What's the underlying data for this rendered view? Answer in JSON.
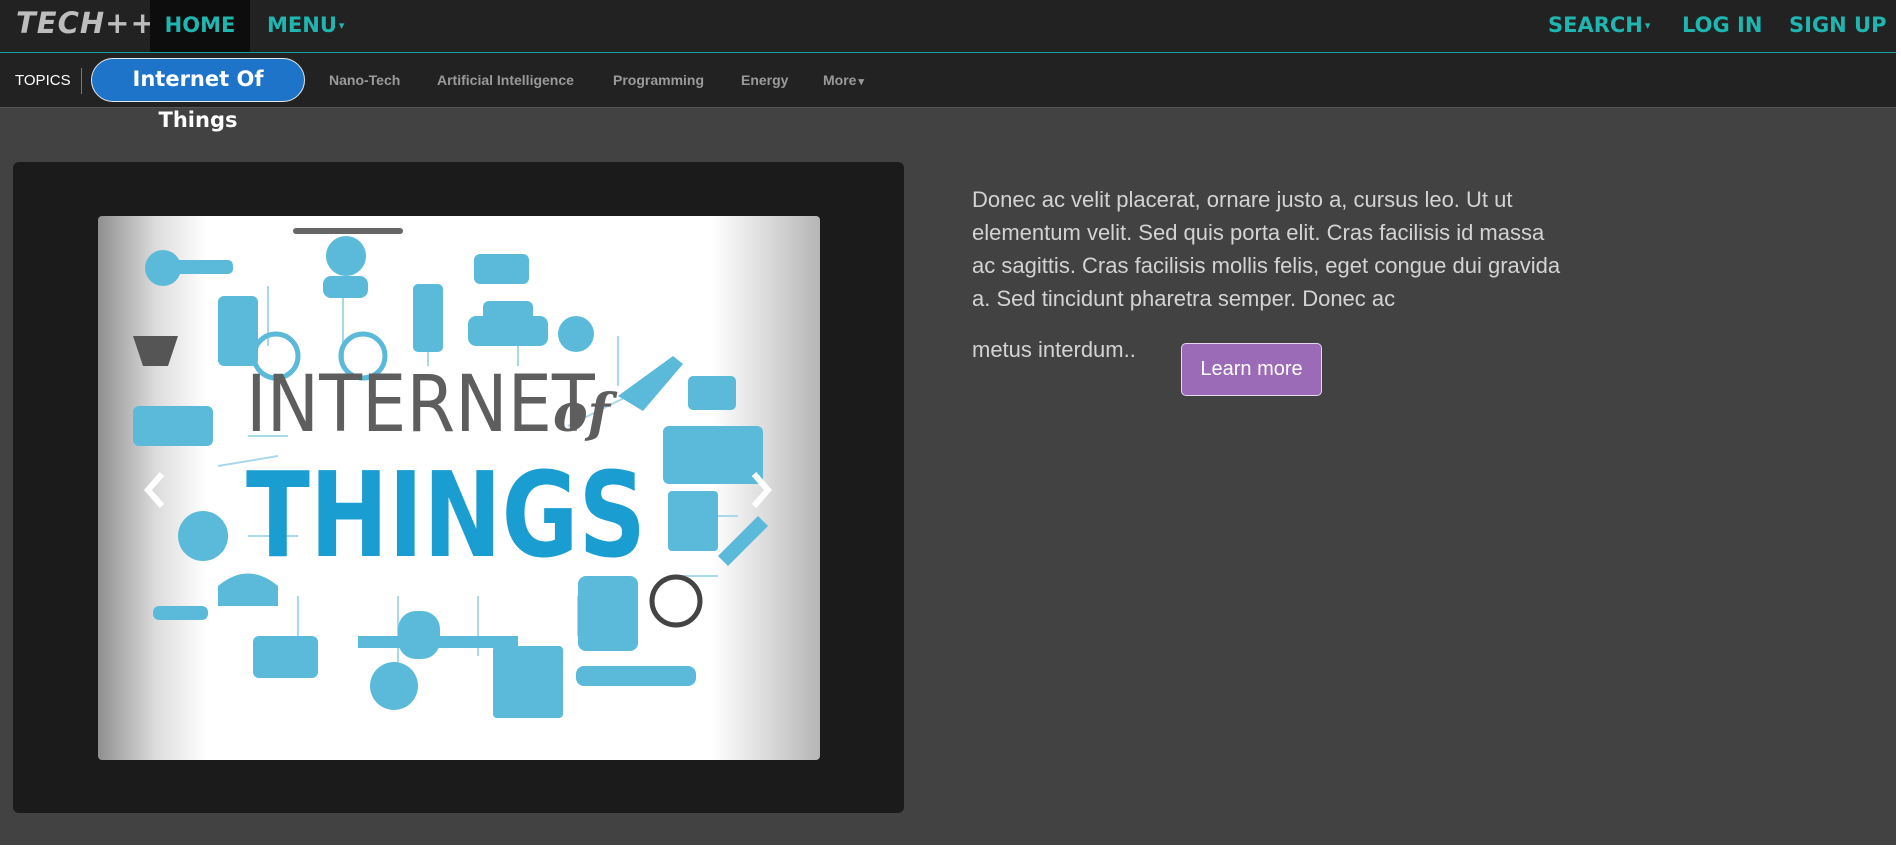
{
  "brand": {
    "name": "TECH++"
  },
  "nav": {
    "home": "HOME",
    "menu": "MENU",
    "search": "SEARCH",
    "login": "LOG IN",
    "signup": "SIGN UP"
  },
  "topics": {
    "label": "TOPICS",
    "active": "Internet Of Things",
    "items": [
      "Nano-Tech",
      "Artificial Intelligence",
      "Programming",
      "Energy"
    ],
    "more": "More"
  },
  "hero": {
    "image_line1": "INTERNET",
    "image_of": "of",
    "image_line2": "THINGS",
    "text": "Donec ac velit placerat, ornare justo a, cursus leo. Ut ut elementum velit. Sed quis porta elit. Cras facilisis id massa ac sagittis. Cras facilisis mollis felis, eget congue dui gravida a. Sed tincidunt pharetra semper. Donec ac",
    "text_end": "metus interdum..",
    "button": "Learn more"
  },
  "colors": {
    "accent": "#1fb5b0",
    "pill": "#1e74c8",
    "button": "#9b6bb8",
    "icon_blue": "#5bbad9",
    "things_blue": "#1a9dd0"
  },
  "icons": [
    "caret-down-icon",
    "chevron-left-icon",
    "chevron-right-icon"
  ]
}
